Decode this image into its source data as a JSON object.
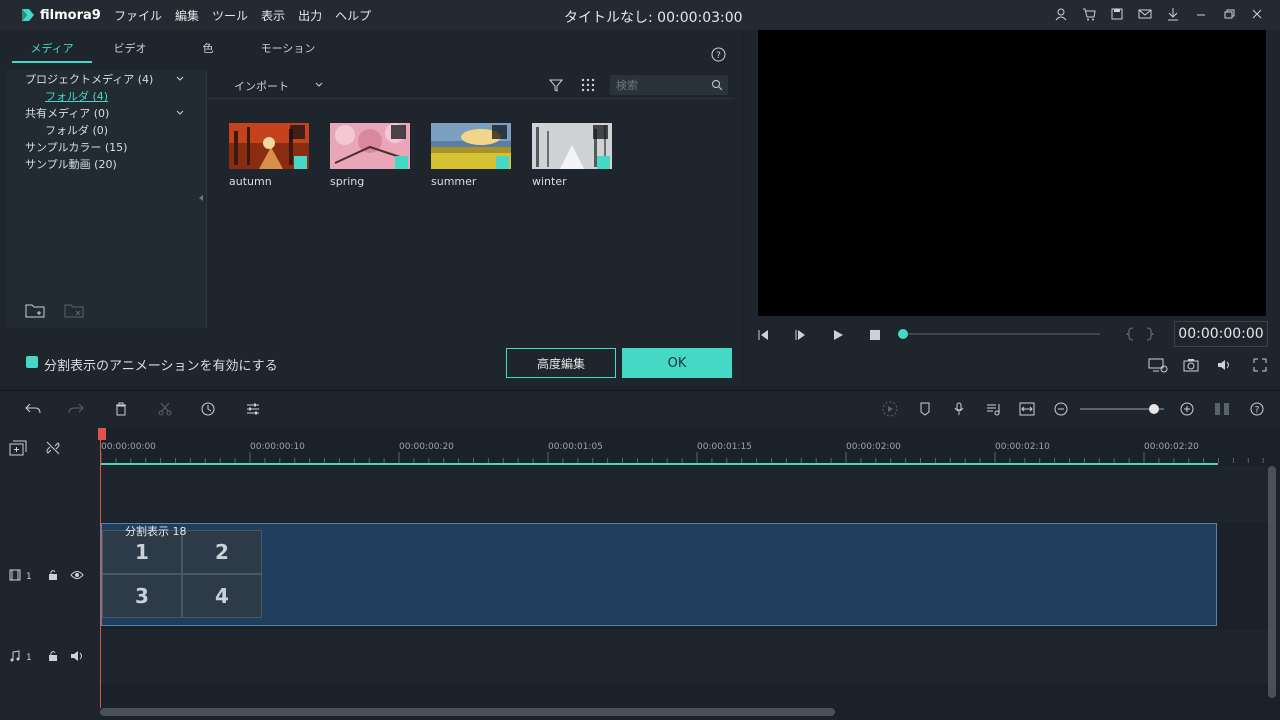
{
  "app": {
    "logo": "filmora9",
    "menu": [
      "ファイル",
      "編集",
      "ツール",
      "表示",
      "出力",
      "ヘルプ"
    ],
    "title": "タイトルなし: 00:00:03:00"
  },
  "panel": {
    "tabs": [
      "メディア",
      "ビデオ",
      "色",
      "モーション"
    ],
    "library": [
      {
        "label": "プロジェクトメディア (4)"
      },
      {
        "label": "フォルダ (4)"
      },
      {
        "label": "共有メディア (0)"
      },
      {
        "label": "フォルダ (0)"
      },
      {
        "label": "サンプルカラー (15)"
      },
      {
        "label": "サンプル動画 (20)"
      }
    ],
    "import_label": "インポート",
    "search_placeholder": "検索",
    "media_items": [
      {
        "name": "autumn"
      },
      {
        "name": "spring"
      },
      {
        "name": "summer"
      },
      {
        "name": "winter"
      }
    ],
    "checkbox_label": "分割表示のアニメーションを有効にする",
    "advanced_button": "高度編集",
    "ok_button": "OK"
  },
  "preview": {
    "timecode": "00:00:00:00",
    "progress": 0
  },
  "timeline": {
    "ruler_labels": [
      "00:00:00:00",
      "00:00:00:10",
      "00:00:00:20",
      "00:00:01:05",
      "00:00:01:15",
      "00:00:02:00",
      "00:00:02:10",
      "00:00:02:20"
    ],
    "clip_label": "分割表示 18",
    "cells": [
      "1",
      "2",
      "3",
      "4"
    ],
    "video_track": "1",
    "audio_track": "1"
  },
  "colors": {
    "accent": "#45d8c5",
    "clip": "#1f3e5e",
    "playhead": "#e0524a"
  }
}
